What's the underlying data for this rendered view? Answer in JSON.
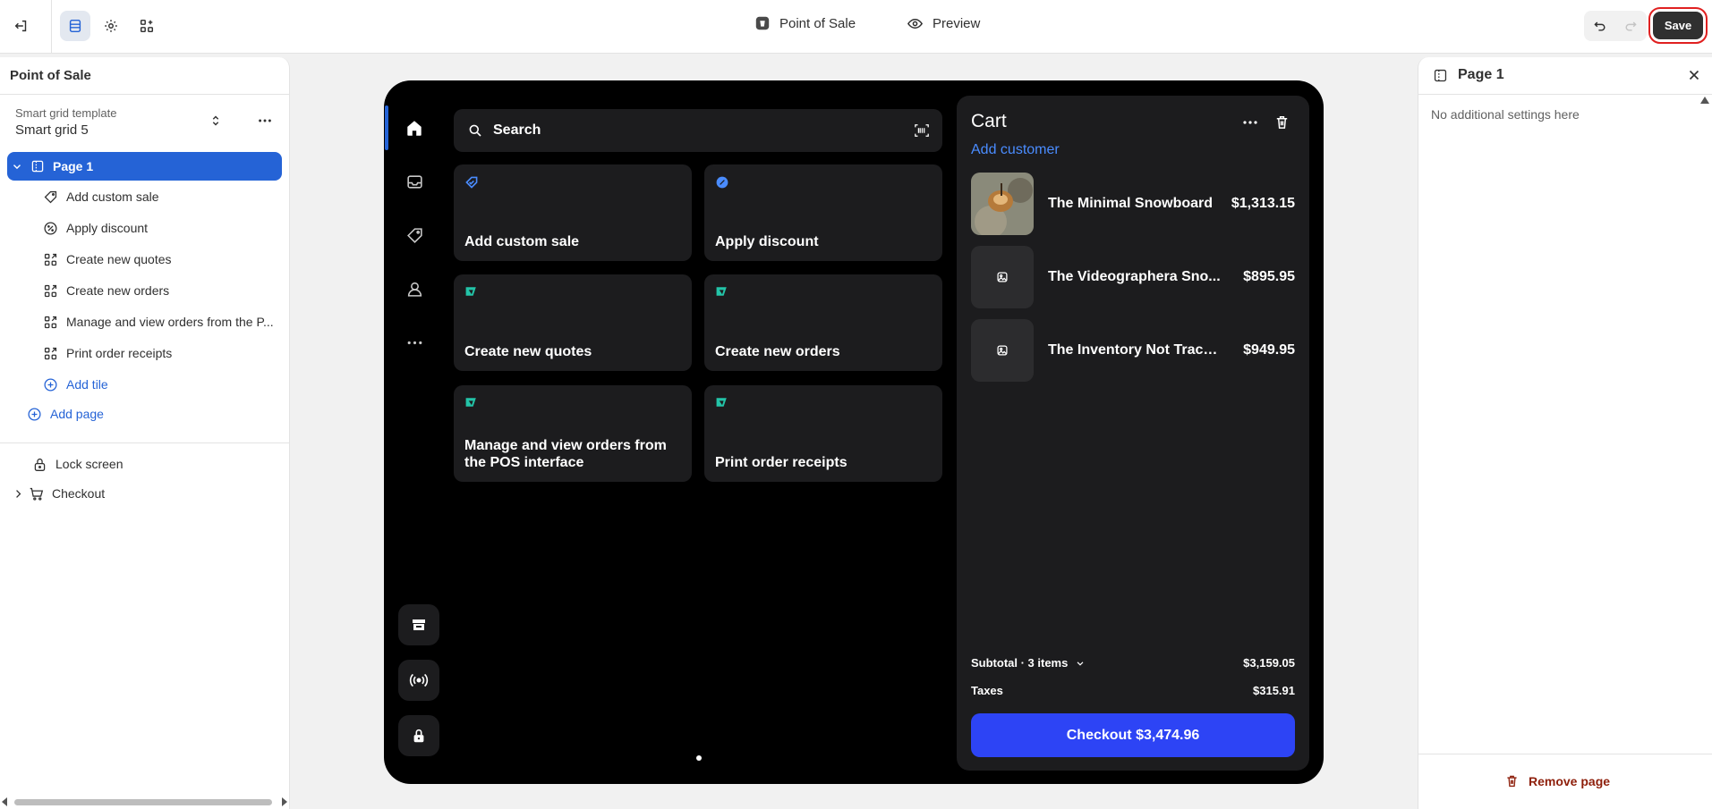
{
  "topbar": {
    "center_title": "Point of Sale",
    "preview_label": "Preview",
    "save_label": "Save"
  },
  "left_panel": {
    "title": "Point of Sale",
    "template_label": "Smart grid template",
    "template_value": "Smart grid 5",
    "page_label": "Page 1",
    "tiles": [
      {
        "label": "Add custom sale",
        "icon": "tag-plus-icon"
      },
      {
        "label": "Apply discount",
        "icon": "discount-icon"
      },
      {
        "label": "Create new quotes",
        "icon": "apps-arrow-icon"
      },
      {
        "label": "Create new orders",
        "icon": "apps-arrow-icon"
      },
      {
        "label": "Manage and view orders from the P...",
        "icon": "apps-arrow-icon"
      },
      {
        "label": "Print order receipts",
        "icon": "apps-arrow-icon"
      }
    ],
    "add_tile": "Add tile",
    "add_page": "Add page",
    "lock_screen": "Lock screen",
    "checkout": "Checkout"
  },
  "pos": {
    "search_placeholder": "Search",
    "tiles": [
      {
        "label": "Add custom sale"
      },
      {
        "label": "Apply discount"
      },
      {
        "label": "Create new quotes"
      },
      {
        "label": "Create new orders"
      },
      {
        "label": "Manage and view orders from the POS interface"
      },
      {
        "label": "Print order receipts"
      }
    ],
    "cart": {
      "title": "Cart",
      "add_customer": "Add customer",
      "items": [
        {
          "name": "The Minimal Snowboard",
          "price": "$1,313.15"
        },
        {
          "name": "The Videographera Sno...",
          "price": "$895.95"
        },
        {
          "name": "The Inventory Not Track...",
          "price": "$949.95"
        }
      ],
      "subtotal_label": "Subtotal · 3 items",
      "subtotal_value": "$3,159.05",
      "taxes_label": "Taxes",
      "taxes_value": "$315.91",
      "checkout_label": "Checkout $3,474.96"
    }
  },
  "right_panel": {
    "title": "Page 1",
    "note": "No additional settings here",
    "remove_label": "Remove page"
  },
  "colors": {
    "accent": "#2563d6",
    "checkout": "#2d44f5",
    "save_highlight": "#e02020"
  }
}
